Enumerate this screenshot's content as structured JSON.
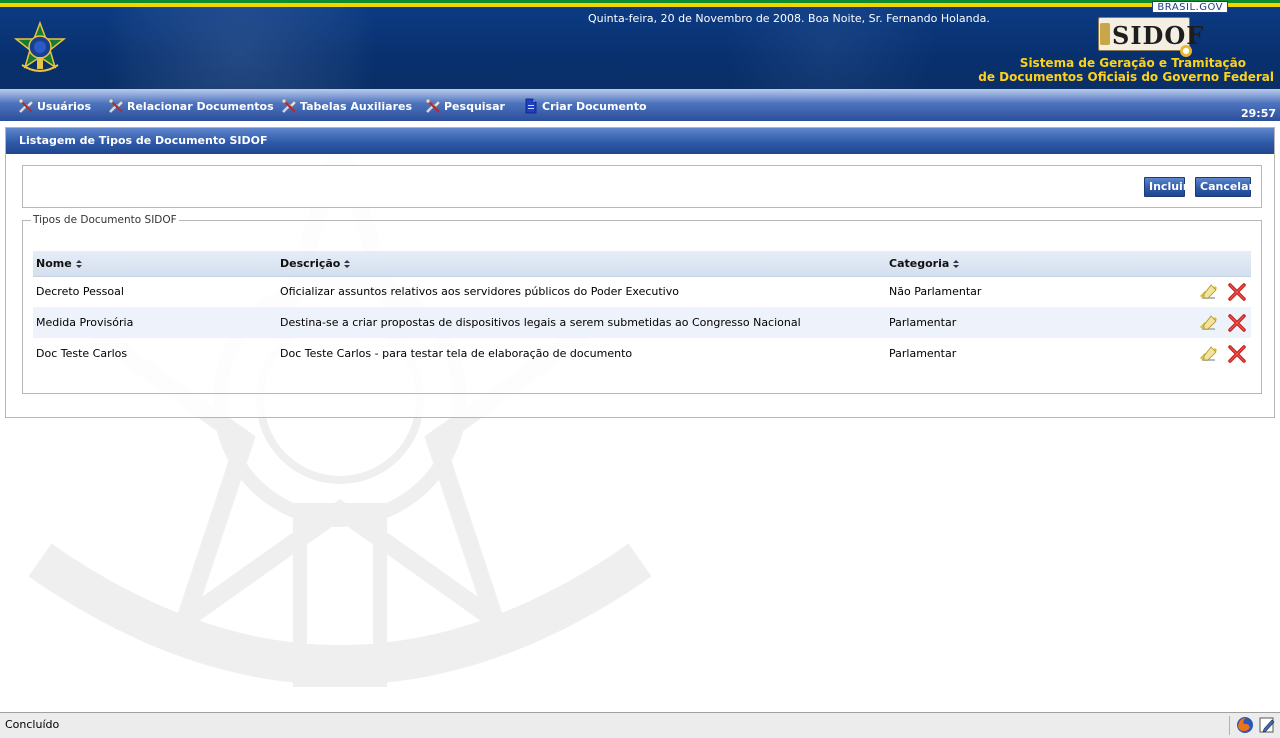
{
  "header": {
    "brasil_gov": "BRASIL.GOV",
    "greeting": "Quinta-feira, 20 de Novembro de 2008. Boa Noite, Sr. Fernando Holanda.",
    "logo_text": "SIDOF",
    "system_name_line1": "Sistema de Geração e Tramitação",
    "system_name_line2": "de Documentos  Oficiais do Governo Federal"
  },
  "menu": {
    "items": [
      {
        "label": "Usuários",
        "icon": "tools-icon"
      },
      {
        "label": "Relacionar Documentos",
        "icon": "tools-icon"
      },
      {
        "label": "Tabelas Auxiliares",
        "icon": "tools-icon"
      },
      {
        "label": "Pesquisar",
        "icon": "tools-icon"
      },
      {
        "label": "Criar Documento",
        "icon": "document-icon"
      }
    ],
    "timer": "29:57"
  },
  "panel": {
    "title": "Listagem de Tipos de Documento SIDOF",
    "buttons": {
      "incluir": "Incluir",
      "cancelar": "Cancelar"
    },
    "fieldset_legend": "Tipos de Documento SIDOF",
    "columns": {
      "nome": "Nome",
      "descricao": "Descrição",
      "categoria": "Categoria"
    },
    "rows": [
      {
        "nome": "Decreto Pessoal",
        "descricao": "Oficializar assuntos relativos aos servidores públicos do Poder Executivo",
        "categoria": "Não Parlamentar"
      },
      {
        "nome": "Medida Provisória",
        "descricao": "Destina-se a criar propostas de dispositivos legais a serem submetidas ao Congresso Nacional",
        "categoria": "Parlamentar"
      },
      {
        "nome": "Doc Teste Carlos",
        "descricao": "Doc Teste Carlos - para testar tela de elaboração de documento",
        "categoria": "Parlamentar"
      }
    ]
  },
  "status": {
    "text": "Concluído"
  },
  "colors": {
    "header_blue": "#0c3b83",
    "accent_yellow": "#ffd21a",
    "flag_green": "#0f8a2e",
    "delete_red": "#c8201c"
  }
}
